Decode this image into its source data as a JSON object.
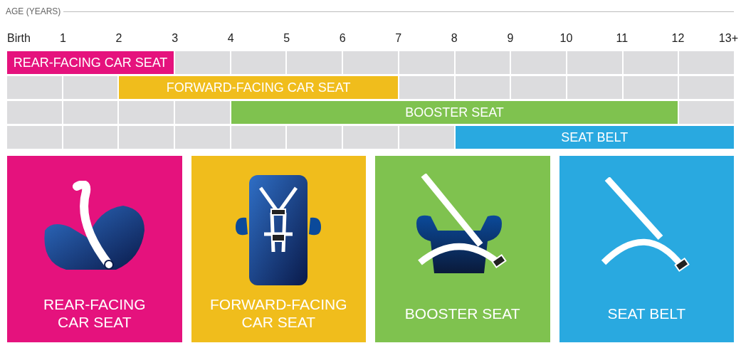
{
  "axis": {
    "title": "AGE (YEARS)",
    "ticks": [
      "Birth",
      "1",
      "2",
      "3",
      "4",
      "5",
      "6",
      "7",
      "8",
      "9",
      "10",
      "11",
      "12",
      "13+"
    ]
  },
  "stages": [
    {
      "label": "REAR-FACING CAR SEAT",
      "color": "#e5127d",
      "filled": [
        true,
        true,
        true,
        false,
        false,
        false,
        false,
        false,
        false,
        false,
        false,
        false,
        false
      ]
    },
    {
      "label": "FORWARD-FACING CAR SEAT",
      "color": "#f0bd1c",
      "filled": [
        false,
        false,
        true,
        true,
        true,
        true,
        true,
        false,
        false,
        false,
        false,
        false,
        false
      ]
    },
    {
      "label": "BOOSTER SEAT",
      "color": "#7fc24f",
      "filled": [
        false,
        false,
        false,
        false,
        true,
        true,
        true,
        true,
        true,
        true,
        true,
        true,
        false
      ]
    },
    {
      "label": "SEAT BELT",
      "color": "#29a9e0",
      "filled": [
        false,
        false,
        false,
        false,
        false,
        false,
        false,
        false,
        true,
        true,
        true,
        true,
        true
      ]
    }
  ],
  "cards": [
    {
      "kind": "rear-facing",
      "color": "#e5127d",
      "lines": [
        "REAR-FACING",
        "CAR SEAT"
      ]
    },
    {
      "kind": "forward-facing",
      "color": "#f0bd1c",
      "lines": [
        "FORWARD-FACING",
        "CAR SEAT"
      ]
    },
    {
      "kind": "booster",
      "color": "#7fc24f",
      "lines": [
        "BOOSTER SEAT"
      ]
    },
    {
      "kind": "belt",
      "color": "#29a9e0",
      "lines": [
        "SEAT BELT"
      ]
    }
  ]
}
